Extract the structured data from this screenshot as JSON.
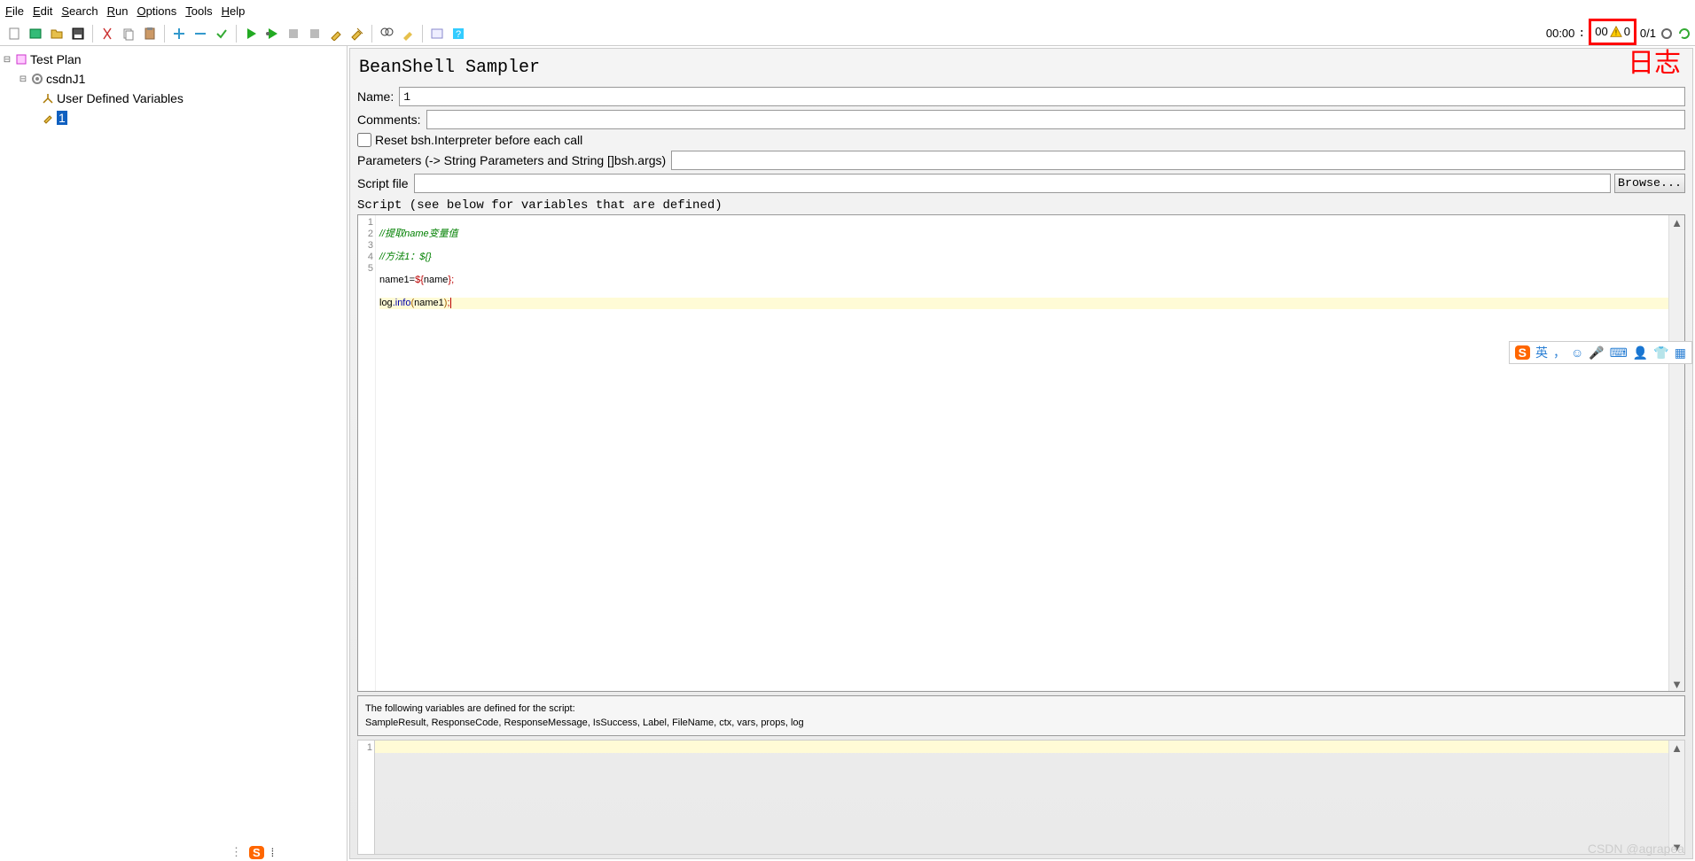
{
  "menu": {
    "file": "File",
    "edit": "Edit",
    "search": "Search",
    "run": "Run",
    "options": "Options",
    "tools": "Tools",
    "help": "Help"
  },
  "status": {
    "time": "00:00",
    "time2": "00",
    "warn_count": "0",
    "threads": "0/1"
  },
  "tree": {
    "root": "Test Plan",
    "thread": "csdnJ1",
    "udv": "User Defined Variables",
    "sampler": "1"
  },
  "panel": {
    "title": "BeanShell Sampler",
    "name_label": "Name:",
    "name_value": "1",
    "comments_label": "Comments:",
    "comments_value": "",
    "reset_label": "Reset bsh.Interpreter before each call",
    "params_label": "Parameters (-> String Parameters and String []bsh.args)",
    "params_value": "",
    "scriptfile_label": "Script file",
    "scriptfile_value": "",
    "browse": "Browse...",
    "script_label": "Script (see below for variables that are defined)"
  },
  "code": {
    "l1": "//提取name变量值",
    "l2": "//方法1：${}",
    "l3_a": "name1=",
    "l3_b": "$",
    "l3_c": "{",
    "l3_d": "name",
    "l3_e": "}",
    "l3_f": ";",
    "l4_a": "log",
    "l4_b": ".info",
    "l4_c": "(",
    "l4_d": "name1",
    "l4_e": ")",
    "l4_f": ";",
    "gut": [
      "1",
      "2",
      "3",
      "4",
      "5"
    ]
  },
  "varsnote": {
    "l1": "The following variables are defined for the script:",
    "l2": "SampleResult, ResponseCode, ResponseMessage, IsSuccess, Label, FileName, ctx, vars, props, log"
  },
  "log_gut": "1",
  "ime": {
    "lang": "英",
    "comma": "，"
  },
  "rizi": "日志",
  "watermark": "CSDN @agrapea"
}
